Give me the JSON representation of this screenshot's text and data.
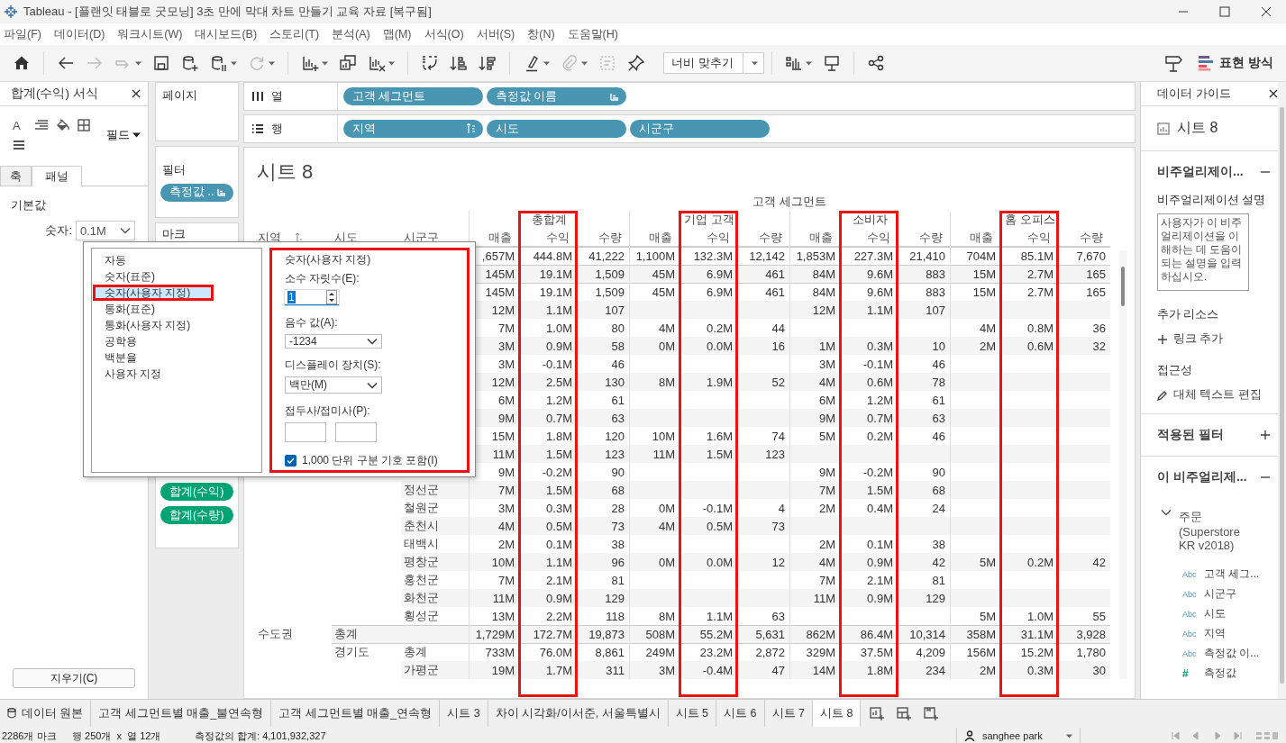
{
  "window": {
    "title": "Tableau - [플랜잇 태블로 굿모닝] 3초 만에 막대 차트 만들기 교육 자료 [복구됨]"
  },
  "menu": [
    "파일(F)",
    "데이터(D)",
    "워크시트(W)",
    "대시보드(B)",
    "스토리(T)",
    "분석(A)",
    "맵(M)",
    "서식(O)",
    "서버(S)",
    "창(N)",
    "도움말(H)"
  ],
  "toolbar": {
    "items": [
      {
        "kind": "home",
        "disabled": false,
        "dropdown": false
      },
      {
        "kind": "separator"
      },
      {
        "kind": "back",
        "disabled": false,
        "dropdown": false
      },
      {
        "kind": "forward",
        "disabled": true,
        "dropdown": false
      },
      {
        "kind": "redo",
        "disabled": true,
        "dropdown": true
      },
      {
        "kind": "save",
        "disabled": false,
        "dropdown": false
      },
      {
        "kind": "db_plus",
        "disabled": false,
        "dropdown": false
      },
      {
        "kind": "db_pause",
        "disabled": false,
        "dropdown": true
      },
      {
        "kind": "refresh",
        "disabled": true,
        "dropdown": true
      },
      {
        "kind": "separator"
      },
      {
        "kind": "chart_plus",
        "disabled": false,
        "dropdown": true
      },
      {
        "kind": "duplicate",
        "disabled": false,
        "dropdown": false
      },
      {
        "kind": "chart_clear",
        "disabled": false,
        "dropdown": true
      },
      {
        "kind": "separator"
      },
      {
        "kind": "swap",
        "disabled": false,
        "dropdown": false
      },
      {
        "kind": "sort_asc",
        "disabled": false,
        "dropdown": false
      },
      {
        "kind": "sort_desc",
        "disabled": false,
        "dropdown": false
      },
      {
        "kind": "separator"
      },
      {
        "kind": "highlight",
        "disabled": false,
        "dropdown": true
      },
      {
        "kind": "annotate",
        "disabled": true,
        "dropdown": true
      },
      {
        "kind": "label",
        "disabled": true,
        "dropdown": false
      },
      {
        "kind": "pin",
        "disabled": false,
        "dropdown": false
      },
      {
        "kind": "fit_select",
        "label": "너비 맞추기"
      },
      {
        "kind": "separator"
      },
      {
        "kind": "show_me_chart",
        "disabled": false,
        "dropdown": true
      },
      {
        "kind": "present",
        "disabled": false,
        "dropdown": false
      },
      {
        "kind": "separator"
      },
      {
        "kind": "share",
        "disabled": false,
        "dropdown": false
      }
    ],
    "show_me": "표현 방식"
  },
  "format_pane": {
    "title": "합계(수익) 서식",
    "font_glyph": "A",
    "field_menu": "필드",
    "tabs": [
      {
        "label": "축",
        "selected": false
      },
      {
        "label": "패널",
        "selected": true
      }
    ],
    "section": "기본값",
    "number_label": "숫자:",
    "number_value": "0.1M",
    "clear_button": "지우기(C)"
  },
  "shelves": {
    "pages": {
      "title": "페이지"
    },
    "filters": {
      "title": "필터",
      "pills": [
        {
          "label": "측정값 ..",
          "kind": "dimension",
          "list_icon": true
        }
      ]
    },
    "marks": {
      "title": "마크",
      "pills": [
        {
          "label": "합계(수익)",
          "kind": "measure"
        },
        {
          "label": "합계(수량)",
          "kind": "measure"
        }
      ]
    },
    "columns": {
      "label": "열",
      "pills": [
        {
          "label": "고객 세그먼트",
          "kind": "dimension"
        },
        {
          "label": "측정값 이름",
          "kind": "dimension",
          "list_icon": true
        }
      ]
    },
    "rows": {
      "label": "행",
      "pills": [
        {
          "label": "지역",
          "kind": "dimension",
          "sort_icon": true
        },
        {
          "label": "시도",
          "kind": "dimension"
        },
        {
          "label": "시군구",
          "kind": "dimension"
        }
      ]
    }
  },
  "sheet": {
    "title": "시트 8",
    "header": "고객 세그먼트",
    "segments": [
      {
        "label": "총합계",
        "measures": [
          {
            "label": "매출",
            "highlighted": false
          },
          {
            "label": "수익",
            "highlighted": true
          },
          {
            "label": "수량",
            "highlighted": false
          }
        ]
      },
      {
        "label": "기업 고객",
        "measures": [
          {
            "label": "매출",
            "highlighted": false
          },
          {
            "label": "수익",
            "highlighted": true
          },
          {
            "label": "수량",
            "highlighted": false
          }
        ]
      },
      {
        "label": "소비자",
        "measures": [
          {
            "label": "매출",
            "highlighted": false
          },
          {
            "label": "수익",
            "highlighted": true
          },
          {
            "label": "수량",
            "highlighted": false
          }
        ]
      },
      {
        "label": "홈 오피스",
        "measures": [
          {
            "label": "매출",
            "highlighted": false
          },
          {
            "label": "수익",
            "highlighted": true
          },
          {
            "label": "수량",
            "highlighted": false
          }
        ]
      }
    ],
    "row_headers": [
      "지역",
      "시도",
      "시군구"
    ],
    "rows": [
      {
        "kind": "total",
        "total": {
          "sales": ",657M",
          "profit": "444.8M",
          "quantity": "41,222"
        },
        "corporate": {
          "sales": "1,100M",
          "profit": "132.3M",
          "quantity": "12,142"
        },
        "consumer": {
          "sales": "1,853M",
          "profit": "227.3M",
          "quantity": "21,410"
        },
        "home_office": {
          "sales": "704M",
          "profit": "85.1M",
          "quantity": "7,670"
        }
      },
      {
        "kind": "total",
        "total": {
          "sales": "145M",
          "profit": "19.1M",
          "quantity": "1,509"
        },
        "corporate": {
          "sales": "45M",
          "profit": "6.9M",
          "quantity": "461"
        },
        "consumer": {
          "sales": "84M",
          "profit": "9.6M",
          "quantity": "883"
        },
        "home_office": {
          "sales": "15M",
          "profit": "2.7M",
          "quantity": "165"
        }
      },
      {
        "kind": "total",
        "total": {
          "sales": "145M",
          "profit": "19.1M",
          "quantity": "1,509"
        },
        "corporate": {
          "sales": "45M",
          "profit": "6.9M",
          "quantity": "461"
        },
        "consumer": {
          "sales": "84M",
          "profit": "9.6M",
          "quantity": "883"
        },
        "home_office": {
          "sales": "15M",
          "profit": "2.7M",
          "quantity": "165"
        }
      },
      {
        "kind": "detail",
        "total": {
          "sales": "12M",
          "profit": "1.1M",
          "quantity": "107"
        },
        "consumer": {
          "sales": "12M",
          "profit": "1.1M",
          "quantity": "107"
        }
      },
      {
        "kind": "detail",
        "total": {
          "sales": "7M",
          "profit": "1.0M",
          "quantity": "80"
        },
        "corporate": {
          "sales": "4M",
          "profit": "0.2M",
          "quantity": "44"
        },
        "home_office": {
          "sales": "4M",
          "profit": "0.8M",
          "quantity": "36"
        }
      },
      {
        "kind": "detail",
        "total": {
          "sales": "3M",
          "profit": "0.9M",
          "quantity": "58"
        },
        "corporate": {
          "sales": "0M",
          "profit": "0.0M",
          "quantity": "16"
        },
        "consumer": {
          "sales": "1M",
          "profit": "0.3M",
          "quantity": "10"
        },
        "home_office": {
          "sales": "2M",
          "profit": "0.6M",
          "quantity": "32"
        }
      },
      {
        "kind": "detail",
        "total": {
          "sales": "3M",
          "profit": "-0.1M",
          "quantity": "46"
        },
        "consumer": {
          "sales": "3M",
          "profit": "-0.1M",
          "quantity": "46"
        }
      },
      {
        "kind": "detail",
        "total": {
          "sales": "12M",
          "profit": "2.5M",
          "quantity": "130"
        },
        "corporate": {
          "sales": "8M",
          "profit": "1.9M",
          "quantity": "52"
        },
        "consumer": {
          "sales": "4M",
          "profit": "0.6M",
          "quantity": "78"
        }
      },
      {
        "kind": "detail",
        "total": {
          "sales": "6M",
          "profit": "1.2M",
          "quantity": "61"
        },
        "consumer": {
          "sales": "6M",
          "profit": "1.2M",
          "quantity": "61"
        }
      },
      {
        "kind": "detail",
        "total": {
          "sales": "9M",
          "profit": "0.7M",
          "quantity": "63"
        },
        "consumer": {
          "sales": "9M",
          "profit": "0.7M",
          "quantity": "63"
        }
      },
      {
        "kind": "detail",
        "total": {
          "sales": "15M",
          "profit": "1.8M",
          "quantity": "120"
        },
        "corporate": {
          "sales": "10M",
          "profit": "1.6M",
          "quantity": "74"
        },
        "consumer": {
          "sales": "5M",
          "profit": "0.2M",
          "quantity": "46"
        }
      },
      {
        "kind": "detail",
        "total": {
          "sales": "11M",
          "profit": "1.5M",
          "quantity": "123"
        },
        "corporate": {
          "sales": "11M",
          "profit": "1.5M",
          "quantity": "123"
        }
      },
      {
        "kind": "detail",
        "total": {
          "sales": "9M",
          "profit": "-0.2M",
          "quantity": "90"
        },
        "consumer": {
          "sales": "9M",
          "profit": "-0.2M",
          "quantity": "90"
        }
      },
      {
        "kind": "detail",
        "district": "정선군",
        "total": {
          "sales": "7M",
          "profit": "1.5M",
          "quantity": "68"
        },
        "consumer": {
          "sales": "7M",
          "profit": "1.5M",
          "quantity": "68"
        }
      },
      {
        "kind": "detail",
        "district": "철원군",
        "total": {
          "sales": "3M",
          "profit": "0.3M",
          "quantity": "28"
        },
        "corporate": {
          "sales": "0M",
          "profit": "-0.1M",
          "quantity": "4"
        },
        "consumer": {
          "sales": "2M",
          "profit": "0.4M",
          "quantity": "24"
        }
      },
      {
        "kind": "detail",
        "district": "춘천시",
        "total": {
          "sales": "4M",
          "profit": "0.5M",
          "quantity": "73"
        },
        "corporate": {
          "sales": "4M",
          "profit": "0.5M",
          "quantity": "73"
        }
      },
      {
        "kind": "detail",
        "district": "태백시",
        "total": {
          "sales": "2M",
          "profit": "0.1M",
          "quantity": "38"
        },
        "consumer": {
          "sales": "2M",
          "profit": "0.1M",
          "quantity": "38"
        }
      },
      {
        "kind": "detail",
        "district": "평창군",
        "total": {
          "sales": "10M",
          "profit": "1.1M",
          "quantity": "96"
        },
        "corporate": {
          "sales": "0M",
          "profit": "0.0M",
          "quantity": "12"
        },
        "consumer": {
          "sales": "4M",
          "profit": "0.9M",
          "quantity": "42"
        },
        "home_office": {
          "sales": "5M",
          "profit": "0.2M",
          "quantity": "42"
        }
      },
      {
        "kind": "detail",
        "district": "홍천군",
        "total": {
          "sales": "7M",
          "profit": "2.1M",
          "quantity": "81"
        },
        "consumer": {
          "sales": "7M",
          "profit": "2.1M",
          "quantity": "81"
        }
      },
      {
        "kind": "detail",
        "district": "화천군",
        "total": {
          "sales": "11M",
          "profit": "0.9M",
          "quantity": "129"
        },
        "consumer": {
          "sales": "11M",
          "profit": "0.9M",
          "quantity": "129"
        }
      },
      {
        "kind": "detail",
        "district": "횡성군",
        "total": {
          "sales": "13M",
          "profit": "2.2M",
          "quantity": "118"
        },
        "corporate": {
          "sales": "8M",
          "profit": "1.1M",
          "quantity": "63"
        },
        "home_office": {
          "sales": "5M",
          "profit": "1.0M",
          "quantity": "55"
        }
      },
      {
        "kind": "total",
        "region": "수도권",
        "province": "총계",
        "total": {
          "sales": "1,729M",
          "profit": "172.7M",
          "quantity": "19,873"
        },
        "corporate": {
          "sales": "508M",
          "profit": "55.2M",
          "quantity": "5,631"
        },
        "consumer": {
          "sales": "862M",
          "profit": "86.4M",
          "quantity": "10,314"
        },
        "home_office": {
          "sales": "358M",
          "profit": "31.1M",
          "quantity": "3,928"
        }
      },
      {
        "kind": "total",
        "province": "경기도",
        "district": "총계",
        "total": {
          "sales": "733M",
          "profit": "76.0M",
          "quantity": "8,861"
        },
        "corporate": {
          "sales": "249M",
          "profit": "23.2M",
          "quantity": "2,872"
        },
        "consumer": {
          "sales": "329M",
          "profit": "37.5M",
          "quantity": "4,209"
        },
        "home_office": {
          "sales": "156M",
          "profit": "15.2M",
          "quantity": "1,780"
        }
      },
      {
        "kind": "detail",
        "district": "가평군",
        "total": {
          "sales": "19M",
          "profit": "1.7M",
          "quantity": "311"
        },
        "corporate": {
          "sales": "3M",
          "profit": "-0.4M",
          "quantity": "47"
        },
        "consumer": {
          "sales": "14M",
          "profit": "1.8M",
          "quantity": "234"
        },
        "home_office": {
          "sales": "2M",
          "profit": "0.3M",
          "quantity": "30"
        }
      }
    ]
  },
  "format_dialog": {
    "formats": [
      {
        "label": "자동",
        "selected": false,
        "highlighted": false
      },
      {
        "label": "숫자(표준)",
        "selected": false,
        "highlighted": false
      },
      {
        "label": "숫자(사용자 지정)",
        "selected": true,
        "highlighted": true
      },
      {
        "label": "통화(표준)",
        "selected": false,
        "highlighted": false
      },
      {
        "label": "통화(사용자 지정)",
        "selected": false,
        "highlighted": false
      },
      {
        "label": "공학용",
        "selected": false,
        "highlighted": false
      },
      {
        "label": "백분율",
        "selected": false,
        "highlighted": false
      },
      {
        "label": "사용자 지정",
        "selected": false,
        "highlighted": false
      }
    ],
    "settings": {
      "highlighted": true,
      "title": "숫자(사용자 지정)",
      "decimals_label": "소수 자릿수(E):",
      "decimals": "1",
      "negative_label": "음수 값(A):",
      "negative": "-1234",
      "units_label": "디스플레이 장치(S):",
      "units": "백만(M)",
      "affix_label": "접두사/접미사(P):",
      "separator_label": "1,000 단위 구분 기호 포함(I)",
      "separator_checked": true
    }
  },
  "data_guide": {
    "title": "데이터 가이드",
    "sheet": "시트 8",
    "viz_section": {
      "title": "비주얼리제이...",
      "expanded": true
    },
    "description": {
      "label": "비주얼리제이션 설명",
      "placeholder": "사용자가 이 비주얼리제이션을 이해하는 데 도움이 되는 설명을 입력하십시오."
    },
    "resources_label": "추가 리소스",
    "add_link": "링크 추가",
    "accessibility_label": "접근성",
    "alt_text_link": "대체 텍스트 편집",
    "filters_section": {
      "title": "적용된 필터",
      "expanded": false
    },
    "data_section": {
      "title": "이 비주얼리제...",
      "expanded": true
    },
    "source": {
      "label": "주문 (Superstore KR v2018)",
      "expanded": true,
      "children": [
        {
          "glyph": "Abc",
          "label": "고객 세그...",
          "kind": "dimension"
        },
        {
          "glyph": "Abc",
          "label": "시군구",
          "kind": "dimension"
        },
        {
          "glyph": "Abc",
          "label": "시도",
          "kind": "dimension"
        },
        {
          "glyph": "Abc",
          "label": "지역",
          "kind": "dimension"
        },
        {
          "glyph": "Abc",
          "label": "측정값 이...",
          "kind": "dimension"
        },
        {
          "glyph": "#",
          "label": "측정값",
          "kind": "measure"
        }
      ]
    }
  },
  "sheet_tabs": [
    {
      "label": "데이터 원본",
      "kind": "datasource",
      "selected": false
    },
    {
      "label": "고객 세그먼트별 매출_불연속형",
      "kind": "sheet",
      "selected": false
    },
    {
      "label": "고객 세그먼트별 매출_연속형",
      "kind": "sheet",
      "selected": false
    },
    {
      "label": "시트 3",
      "kind": "sheet",
      "selected": false
    },
    {
      "label": "차이 시각화/이서준, 서울특별시",
      "kind": "sheet",
      "selected": false
    },
    {
      "label": "시트 5",
      "kind": "sheet",
      "selected": false
    },
    {
      "label": "시트 6",
      "kind": "sheet",
      "selected": false
    },
    {
      "label": "시트 7",
      "kind": "sheet",
      "selected": false
    },
    {
      "label": "시트 8",
      "kind": "sheet",
      "selected": true
    }
  ],
  "status": {
    "marks": "2286개 마크",
    "size": "행 250개  x  열 12개",
    "sum": "측정값의 합계: 4,101,932,327",
    "user": "sanghee park"
  }
}
